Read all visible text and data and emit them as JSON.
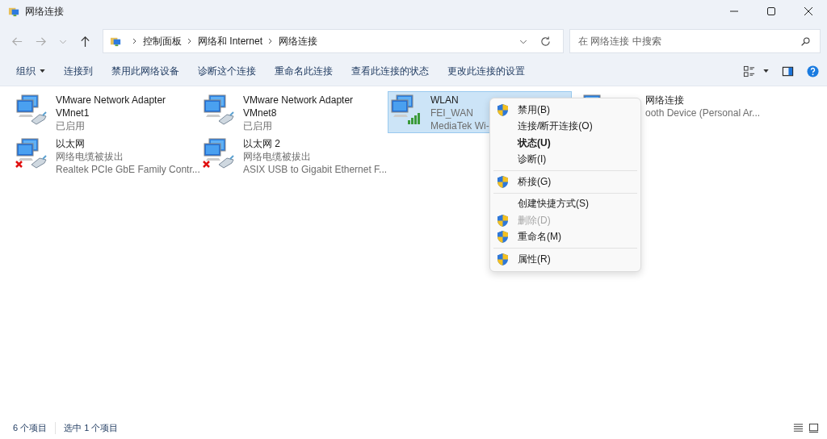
{
  "window": {
    "title": "网络连接"
  },
  "address_bar": {
    "crumbs": [
      "控制面板",
      "网络和 Internet",
      "网络连接"
    ]
  },
  "search": {
    "placeholder": "在 网络连接 中搜索"
  },
  "toolbar": [
    {
      "label": "组织",
      "dropdown": true
    },
    {
      "label": "连接到",
      "dropdown": false
    },
    {
      "label": "禁用此网络设备",
      "dropdown": false
    },
    {
      "label": "诊断这个连接",
      "dropdown": false
    },
    {
      "label": "重命名此连接",
      "dropdown": false
    },
    {
      "label": "查看此连接的状态",
      "dropdown": false
    },
    {
      "label": "更改此连接的设置",
      "dropdown": false
    }
  ],
  "connections": [
    {
      "kind": "wired",
      "name": "VMware Network Adapter VMnet1",
      "status": "已启用",
      "unplugged": false,
      "selected": false
    },
    {
      "kind": "wired",
      "name": "VMware Network Adapter VMnet8",
      "status": "已启用",
      "unplugged": false,
      "selected": false
    },
    {
      "kind": "wifi",
      "name": "WLAN",
      "status": "FEI_WAN",
      "device": "MediaTek Wi-",
      "unplugged": false,
      "selected": true
    },
    {
      "kind": "covered",
      "name": "网络连接",
      "device": "ooth Device (Personal Ar...",
      "selected": false
    },
    {
      "kind": "wired",
      "name": "以太网",
      "status": "网络电缆被拔出",
      "device": "Realtek PCIe GbE Family Contr...",
      "unplugged": true,
      "selected": false
    },
    {
      "kind": "wired",
      "name": "以太网 2",
      "status": "网络电缆被拔出",
      "device": "ASIX USB to Gigabit Ethernet F...",
      "unplugged": true,
      "selected": false
    }
  ],
  "context_menu": [
    {
      "kind": "item",
      "label": "禁用(B)",
      "shield": true,
      "default": false,
      "disabled": false
    },
    {
      "kind": "item",
      "label": "连接/断开连接(O)",
      "shield": false,
      "default": false,
      "disabled": false
    },
    {
      "kind": "item",
      "label": "状态(U)",
      "shield": false,
      "default": true,
      "disabled": false
    },
    {
      "kind": "item",
      "label": "诊断(I)",
      "shield": false,
      "default": false,
      "disabled": false
    },
    {
      "kind": "separator"
    },
    {
      "kind": "item",
      "label": "桥接(G)",
      "shield": true,
      "default": false,
      "disabled": false
    },
    {
      "kind": "separator"
    },
    {
      "kind": "item",
      "label": "创建快捷方式(S)",
      "shield": false,
      "default": false,
      "disabled": false
    },
    {
      "kind": "item",
      "label": "删除(D)",
      "shield": true,
      "default": false,
      "disabled": true
    },
    {
      "kind": "item",
      "label": "重命名(M)",
      "shield": true,
      "default": false,
      "disabled": false
    },
    {
      "kind": "separator"
    },
    {
      "kind": "item",
      "label": "属性(R)",
      "shield": true,
      "default": false,
      "disabled": false
    }
  ],
  "status_bar": {
    "count": "6 个项目",
    "selection": "选中 1 个项目"
  }
}
